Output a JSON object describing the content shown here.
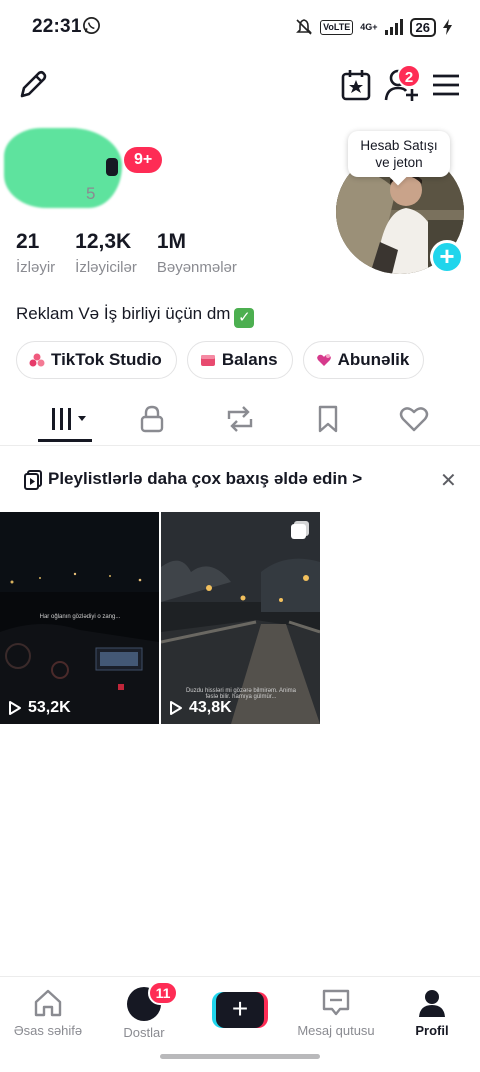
{
  "status_bar": {
    "time": "22:31",
    "volte": "VoLTE",
    "network": "4G+",
    "battery": "26"
  },
  "top_nav": {
    "notification_count": "2"
  },
  "profile": {
    "name_suffix": "5",
    "level_badge": "9+",
    "avatar_tooltip_line1": "Hesab Satışı",
    "avatar_tooltip_line2": "ve jeton",
    "stats": [
      {
        "value": "21",
        "label": "İzləyir"
      },
      {
        "value": "12,3K",
        "label": "İzləyicilər"
      },
      {
        "value": "1M",
        "label": "Bəyənmələr"
      }
    ],
    "bio": "Reklam Və İş birliyi üçün dm",
    "chips": [
      {
        "label": "TikTok Studio",
        "color": "#f05a7e"
      },
      {
        "label": "Balans",
        "color": "#e84a6f"
      },
      {
        "label": "Abunəlik",
        "color": "#d63a8c"
      }
    ]
  },
  "tabs": [
    "videos",
    "private",
    "reposts",
    "favorites",
    "liked"
  ],
  "banner": {
    "text": "Pleylistlərlə daha çox baxış əldə edin >"
  },
  "videos": [
    {
      "views": "53,2K",
      "caption": "Har oğlanın gözlədiyi o zang..."
    },
    {
      "views": "43,8K",
      "caption": "Duzdu hissləri mi gözərə bilmirəm. Anima fəslə bilir. hamıya gülmür..."
    }
  ],
  "bottom_nav": {
    "home": "Əsas səhifə",
    "friends": "Dostlar",
    "friends_badge": "11",
    "inbox": "Mesaj qutusu",
    "profile": "Profil"
  },
  "colors": {
    "accent_red": "#fe2c55",
    "accent_cyan": "#20d5ec",
    "text_primary": "#161823",
    "text_secondary": "#8a8b91"
  }
}
